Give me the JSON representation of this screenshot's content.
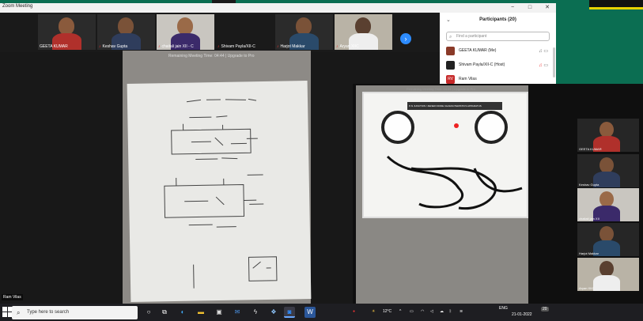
{
  "window": {
    "title": "Zoom Meeting",
    "controls": [
      "−",
      "□",
      "✕"
    ]
  },
  "gallery": {
    "tiles": [
      {
        "name": "GEETA KUMAR",
        "muted": false
      },
      {
        "name": "Keshav Gupta",
        "muted": true
      },
      {
        "name": "chaitali jain XII - C",
        "muted": true
      },
      {
        "name": "Shivam Payla/XII-C",
        "muted": true
      },
      {
        "name": "Harjot Makkar",
        "muted": true
      },
      {
        "name": "Aryan XIIC",
        "muted": true
      }
    ],
    "next_icon": "›"
  },
  "share": {
    "timer_text": "Remaining Meeting Time: 04:44 | Upgrade to Pro",
    "presenter_label": "Ram Vilas"
  },
  "participants": {
    "title": "Participants (20)",
    "collapse_icon": "⌄",
    "search_placeholder": "Find a participant",
    "rows": [
      {
        "initials": "",
        "name": "GEETA KUMAR (Me)",
        "muted": false,
        "video": true
      },
      {
        "initials": "",
        "name": "Shivam Payla/XII-C (Host)",
        "muted": true,
        "video": true
      },
      {
        "initials": "RV",
        "name": "Ram Vilas",
        "muted": false,
        "video": false
      }
    ]
  },
  "second_window": {
    "timer_text": "Remaining Meeting Time: 04:44 | Upgrade to Pro",
    "panel_label": "P-N JUNCTION / ZENER DIODE CHARACTERISTICS APPARATUS"
  },
  "right_strip": {
    "tiles": [
      {
        "name": "GEETA KUMAR"
      },
      {
        "name": "Keshav Gupta"
      },
      {
        "name": "chaitali jain XII"
      },
      {
        "name": "Harjot Makkar"
      },
      {
        "name": "Aryan XIIC"
      }
    ]
  },
  "taskbar": {
    "search_placeholder": "Type here to search",
    "temperature": "12°C",
    "language": "ENG",
    "date": "21-01-2022",
    "notification_count": "20"
  }
}
